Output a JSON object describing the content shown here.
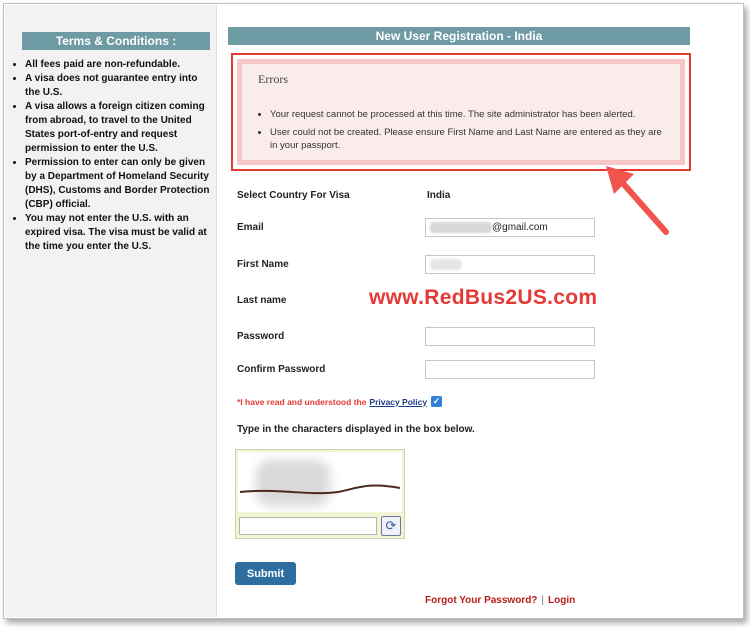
{
  "sidebar": {
    "title": "Terms & Conditions :",
    "terms": [
      "All fees paid are non-refundable.",
      "A visa does not guarantee entry into the U.S.",
      "A visa allows a foreign citizen coming from abroad, to travel to the United States port-of-entry and request permission to enter the U.S.",
      "Permission to enter can only be given by a Department of Homeland Security (DHS), Customs and Border Protection (CBP) official.",
      "You may not enter the U.S. with an expired visa. The visa must be valid at the time you enter the U.S."
    ]
  },
  "main": {
    "title": "New User Registration - India",
    "errors": {
      "heading": "Errors",
      "items": [
        "Your request cannot be processed at this time. The site administrator has been alerted.",
        "User could not be created. Please ensure First Name and Last Name are entered as they are in your passport."
      ]
    },
    "form": {
      "country_label": "Select Country For Visa",
      "country_value": "India",
      "email_label": "Email",
      "email_value_suffix": "@gmail.com",
      "first_name_label": "First Name",
      "last_name_label": "Last name",
      "password_label": "Password",
      "confirm_password_label": "Confirm Password",
      "privacy_text": "*I have read and understood the",
      "privacy_link": "Privacy Policy",
      "captcha_label": "Type in the characters displayed in the box below.",
      "submit_label": "Submit",
      "forgot_password_link": "Forgot Your Password?",
      "separator": "|",
      "login_link": "Login"
    }
  },
  "watermark": "www.RedBus2US.com",
  "colors": {
    "header_bg": "#6e9aa3",
    "error_border": "#e53935",
    "submit_bg": "#2e6e9e",
    "link_red": "#b71c1c",
    "arrow": "#f0544c"
  }
}
